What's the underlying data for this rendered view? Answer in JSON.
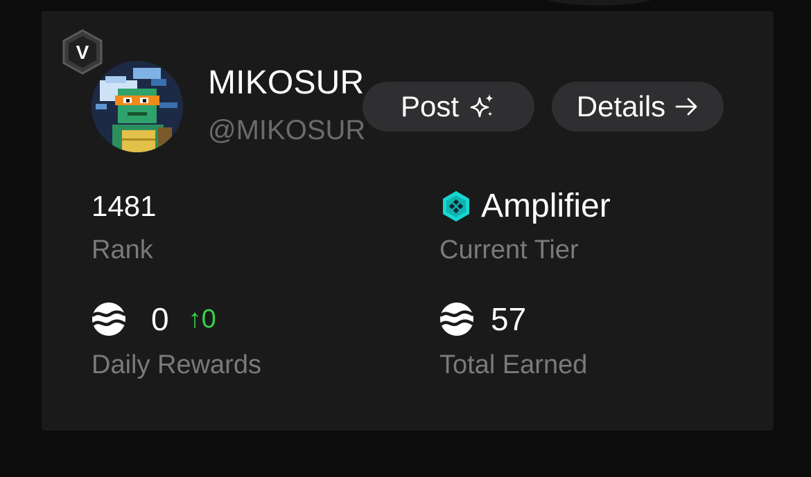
{
  "profile": {
    "verified_letter": "V",
    "name": "MIKOSUR",
    "handle": "@MIKOSUR"
  },
  "actions": {
    "post_label": "Post",
    "details_label": "Details"
  },
  "stats": {
    "rank": {
      "value": "1481",
      "label": "Rank"
    },
    "tier": {
      "value": "Amplifier",
      "label": "Current Tier"
    },
    "daily_rewards": {
      "value": "0",
      "delta": "0",
      "label": "Daily Rewards"
    },
    "total_earned": {
      "value": "57",
      "label": "Total Earned"
    }
  },
  "icons": {
    "verified": "hexagon-badge-icon",
    "post": "sparkle-icon",
    "details": "arrow-right-icon",
    "tier": "teal-hexagon-gem-icon",
    "token": "wave-token-icon",
    "delta": "arrow-up-icon"
  },
  "colors": {
    "background": "#0c0c0d",
    "card": "#1a1a1b",
    "pill": "#2f2f31",
    "muted_text": "#7a7a7c",
    "positive_delta": "#37d24a",
    "tier_accent": "#17d6d0"
  }
}
